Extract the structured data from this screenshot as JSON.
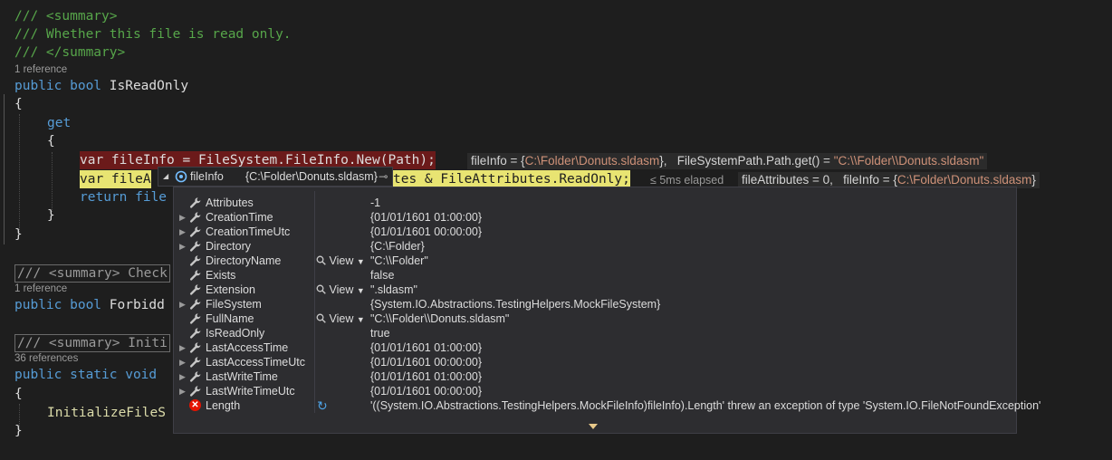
{
  "code": {
    "l1": "/// <summary>",
    "l2": "/// Whether this file is read only.",
    "l3": "/// </summary>",
    "ref1": "1 reference",
    "l4_kw": "public bool ",
    "l4_name": "IsReadOnly",
    "l5": "{",
    "l6": "get",
    "l7": "{",
    "l8": "var fileInfo = FileSystem.FileInfo.New(Path);",
    "l9_start": "var fileA",
    "l9_end": "tes & FileAttributes.ReadOnly;",
    "l10": "return file",
    "l11": "}",
    "l12": "}",
    "collapsed1": "/// <summary> Check",
    "ref2": "1 reference",
    "l13_kw": "public bool ",
    "l13_name": "Forbidd",
    "collapsed2": "/// <summary> Initi",
    "ref3": "36 references",
    "l14_kw": "public static void",
    "l15": "{",
    "l16": "InitializeFileS",
    "l17": "}"
  },
  "inline_hint1": {
    "prefix": "fileInfo = {",
    "path": "C:\\Folder\\Donuts.sldasm",
    "mid": "},   FileSystemPath.Path.get() = ",
    "str": "\"C:\\\\Folder\\\\Donuts.sldasm\""
  },
  "elapsed": "≤ 5ms elapsed",
  "inline_hint2": {
    "prefix": "fileAttributes = 0,   fileInfo = {",
    "path": "C:\\Folder\\Donuts.sldasm",
    "suffix": "}"
  },
  "datatip": {
    "name": "fileInfo",
    "value": "{C:\\Folder\\Donuts.sldasm}",
    "view_label": "View",
    "rows": [
      {
        "name": "Attributes",
        "value": "-1",
        "expandable": false,
        "view": false
      },
      {
        "name": "CreationTime",
        "value": "{01/01/1601 01:00:00}",
        "expandable": true,
        "view": false
      },
      {
        "name": "CreationTimeUtc",
        "value": "{01/01/1601 00:00:00}",
        "expandable": true,
        "view": false
      },
      {
        "name": "Directory",
        "value": "{C:\\Folder}",
        "expandable": true,
        "view": false
      },
      {
        "name": "DirectoryName",
        "value": "\"C:\\\\Folder\"",
        "expandable": false,
        "view": true
      },
      {
        "name": "Exists",
        "value": "false",
        "expandable": false,
        "view": false
      },
      {
        "name": "Extension",
        "value": "\".sldasm\"",
        "expandable": false,
        "view": true
      },
      {
        "name": "FileSystem",
        "value": "{System.IO.Abstractions.TestingHelpers.MockFileSystem}",
        "expandable": true,
        "view": false
      },
      {
        "name": "FullName",
        "value": "\"C:\\\\Folder\\\\Donuts.sldasm\"",
        "expandable": false,
        "view": true
      },
      {
        "name": "IsReadOnly",
        "value": "true",
        "expandable": false,
        "view": false
      },
      {
        "name": "LastAccessTime",
        "value": "{01/01/1601 01:00:00}",
        "expandable": true,
        "view": false
      },
      {
        "name": "LastAccessTimeUtc",
        "value": "{01/01/1601 00:00:00}",
        "expandable": true,
        "view": false
      },
      {
        "name": "LastWriteTime",
        "value": "{01/01/1601 01:00:00}",
        "expandable": true,
        "view": false
      },
      {
        "name": "LastWriteTimeUtc",
        "value": "{01/01/1601 00:00:00}",
        "expandable": true,
        "view": false
      },
      {
        "name": "Length",
        "value": "'((System.IO.Abstractions.TestingHelpers.MockFileInfo)fileInfo).Length' threw an exception of type 'System.IO.FileNotFoundException'",
        "expandable": false,
        "view": false,
        "error": true
      }
    ]
  },
  "colors": {
    "comment": "#57a64a",
    "keyword": "#569cd6",
    "current_statement": "#e8e472",
    "breakpoint_line": "#6b1a1a",
    "string": "#ce9178"
  }
}
